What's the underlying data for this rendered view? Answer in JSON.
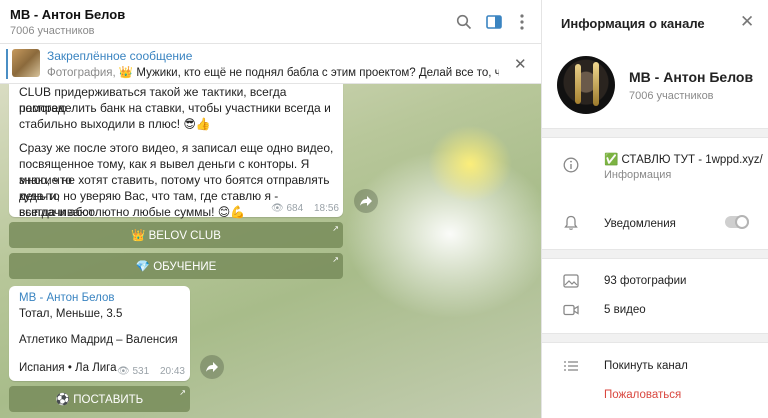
{
  "chat": {
    "title": "MB - Антон Белов",
    "subtitle": "7006 участников",
    "header_icons": [
      "search-icon",
      "sidebar-toggle-icon",
      "more-vertical-icon"
    ]
  },
  "pinned": {
    "title": "Закреплённое сообщение",
    "kind": "Фотография,",
    "text": "👑 Мужики, кто ещё не поднял бабла с этим проектом? Делай все то, что я на..."
  },
  "message1": {
    "lines": [
      "CLUB придерживаться такой же тактики, всегда помогаю",
      "распределить банк на ставки, чтобы участники всегда и",
      "стабильно выходили в плюс! 😎👍",
      "",
      "Сразу же после этого видео, я записал еще одно видео,",
      "посвященное тому, как я вывел деньги с конторы. Я знаю, что",
      "многие не хотят ставить, потому что боятся отправлять куда-то",
      "деньги, но уверяю Вас, что там, где ставлю я - выплачивают",
      "всегда и абсолютно любые суммы! 😊💪"
    ],
    "views": "684",
    "time": "18:56"
  },
  "buttons": {
    "belov_club": "👑 BELOV CLUB",
    "obuchenie": "💎 ОБУЧЕНИЕ",
    "postavit": "⚽ ПОСТАВИТЬ"
  },
  "message2": {
    "author": "MB - Антон Белов",
    "line1": "Тотал, Меньше, 3.5",
    "line2": "Атлетико Мадрид – Валенсия",
    "line3": "Испания • Ла Лига",
    "views": "531",
    "time": "20:43"
  },
  "panel": {
    "title": "Информация о канале",
    "name": "MB - Антон Белов",
    "members": "7006 участников",
    "info_text": "✅ СТАВЛЮ ТУТ - 1wppd.xyz/",
    "info_label": "Информация",
    "notifications": "Уведомления",
    "notifications_on": false,
    "photos": "93 фотографии",
    "videos": "5 видео",
    "leave": "Покинуть канал",
    "report": "Пожаловаться"
  },
  "colors": {
    "accent": "#3a84c1",
    "danger": "#d9473f",
    "button_bg": "#788c5a"
  }
}
